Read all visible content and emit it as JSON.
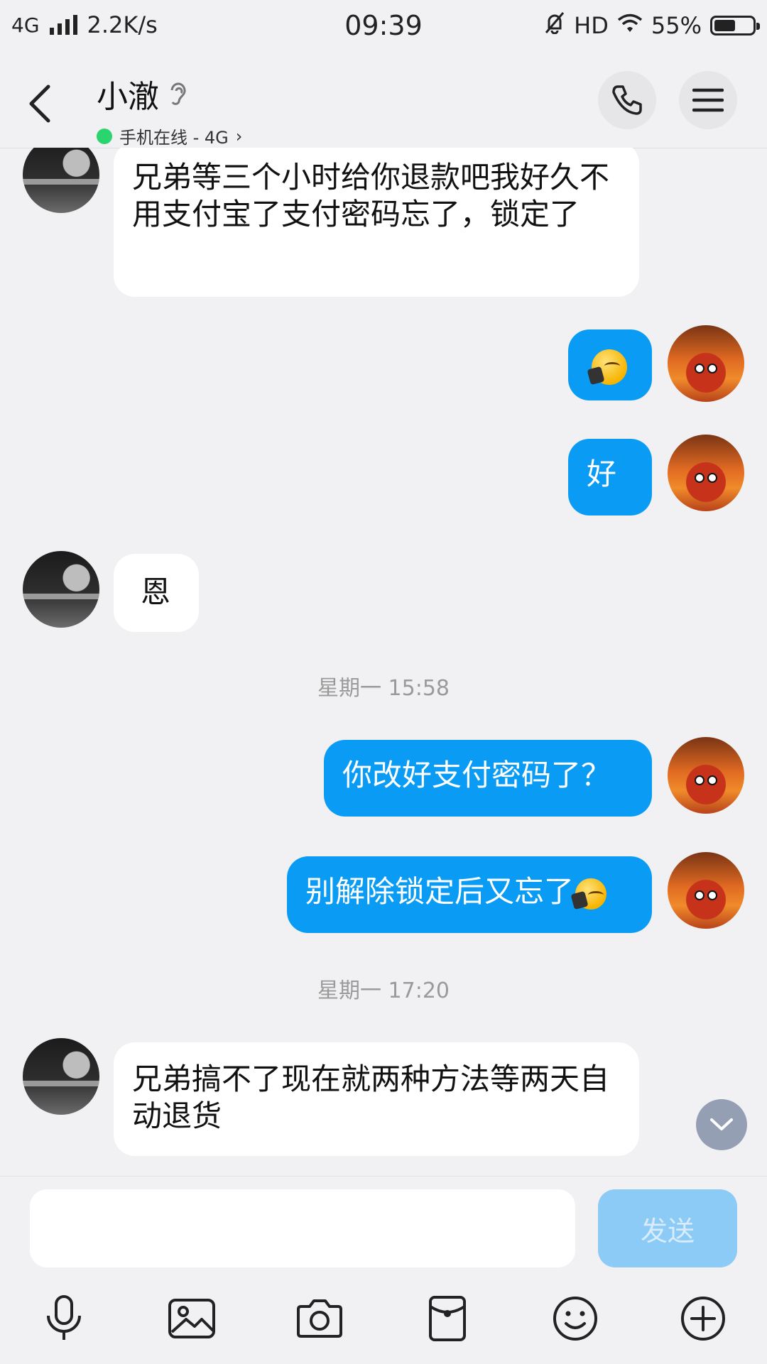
{
  "status_bar": {
    "network": "4G",
    "speed": "2.2K/s",
    "time": "09:39",
    "hd": "HD",
    "battery": "55%",
    "battery_level": 0.55
  },
  "header": {
    "title": "小澈",
    "status_text": "手机在线 - 4G",
    "status_arrow": "›",
    "icons": [
      "back-arrow-icon",
      "ear-icon",
      "phone-icon",
      "menu-icon"
    ]
  },
  "messages": [
    {
      "side": "in",
      "text": "兄弟等三个小时给你退款吧我好久不用支付宝了支付密码忘了，锁定了"
    },
    {
      "side": "out",
      "text": ""
    },
    {
      "side": "out",
      "text": "好"
    },
    {
      "side": "in",
      "text": "恩"
    },
    {
      "side": "out",
      "text": "你改好支付密码了？"
    },
    {
      "side": "out",
      "text": "别解除锁定后又忘了"
    },
    {
      "side": "in",
      "text": "兄弟搞不了现在就两种方法等两天自动退货"
    }
  ],
  "timestamps": [
    "星期一 15:58",
    "星期一 17:20"
  ],
  "composer": {
    "input_value": "",
    "send_label": "发送"
  },
  "toolbar_icons": [
    "microphone-icon",
    "image-icon",
    "camera-icon",
    "red-packet-icon",
    "emoji-icon",
    "plus-icon"
  ],
  "colors": {
    "outgoing_bubble": "#0a9cf5",
    "incoming_bubble": "#ffffff",
    "background": "#f1f1f3",
    "online_dot": "#2bd56e",
    "send_disabled": "#8dcbf7"
  }
}
